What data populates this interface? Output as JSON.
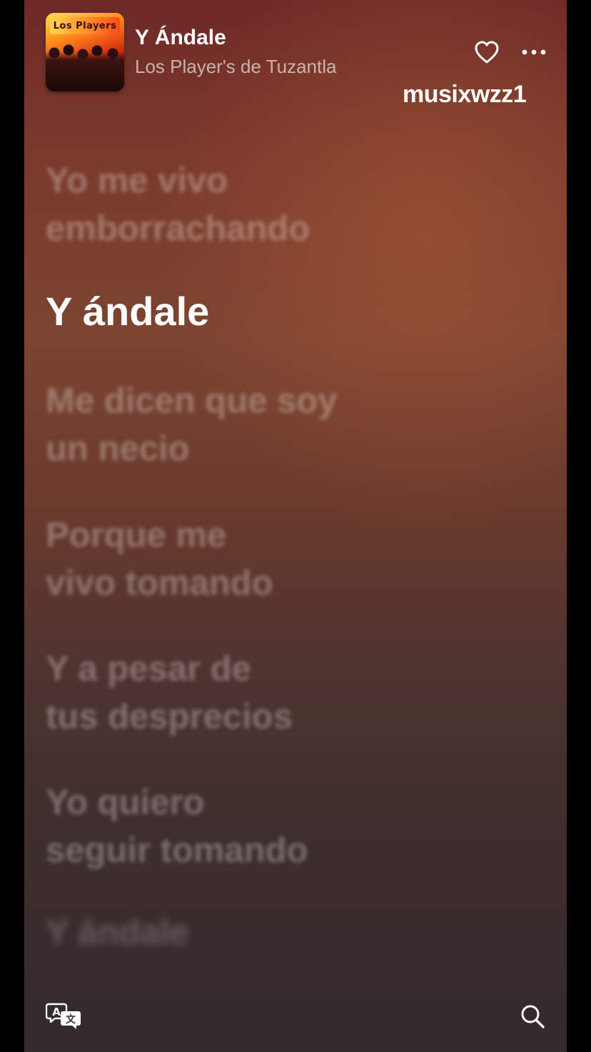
{
  "now_playing": {
    "title": "Y Ándale",
    "artist": "Los Player's de Tuzantla",
    "album_art_text": "Los Players",
    "favorite_icon": "heart-outline-icon",
    "more_icon": "ellipsis-icon"
  },
  "watermark": "musixwzz1",
  "lyrics": [
    {
      "lines": [
        "Yo me vivo",
        "emborrachando"
      ],
      "state": "past"
    },
    {
      "lines": [
        "Y ándale"
      ],
      "state": "current"
    },
    {
      "lines": [
        "Me dicen que soy",
        "un necio"
      ],
      "state": "upcoming"
    },
    {
      "lines": [
        "Porque me",
        "vivo tomando"
      ],
      "state": "upcoming"
    },
    {
      "lines": [
        "Y a pesar de",
        "tus desprecios"
      ],
      "state": "upcoming"
    },
    {
      "lines": [
        "Yo quiero",
        "seguir tomando"
      ],
      "state": "upcoming"
    },
    {
      "lines": [
        "Y ándale"
      ],
      "state": "upcoming"
    }
  ],
  "bottom_bar": {
    "translate_icon": "translate-icon",
    "search_icon": "search-icon"
  },
  "colors": {
    "background_top": "#6e2a27",
    "background_bottom": "#342a2b",
    "active_lyric": "#ffffff"
  }
}
